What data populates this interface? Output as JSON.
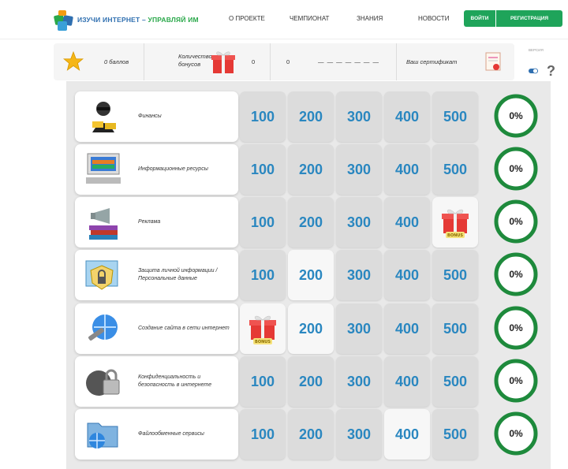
{
  "header": {
    "logo_text_1": "ИЗУЧИ ИНТЕРНЕТ – ",
    "logo_text_2": "УПРАВЛЯЙ ИМ",
    "nav": [
      "О ПРОЕКТЕ",
      "ЧЕМПИОНАТ",
      "ЗНАНИЯ",
      "НОВОСТИ"
    ],
    "login_label": "ВОЙТИ",
    "register_label": "РЕГИСТРАЦИЯ"
  },
  "stats": {
    "points": "0 баллов",
    "bonus_label": "Количество бонусов",
    "bonus_value": "0",
    "rank_value": "0",
    "dashes": "— — — — — — —",
    "certificate_label": "Ваш сертификат"
  },
  "help": {
    "symbol": "?",
    "tiny_label": "ВЕРСИЯ"
  },
  "colors": {
    "accent_green": "#1fa45a",
    "tile_blue": "#2a87c0",
    "ring_green": "#1e8a3c"
  },
  "board": {
    "rows": [
      {
        "category": "Финансы",
        "icon": "hacker-icon",
        "tiles": [
          "100",
          "200",
          "300",
          "400",
          "500"
        ],
        "progress": "0%"
      },
      {
        "category": "Информационные ресурсы",
        "icon": "books-computer-icon",
        "tiles": [
          "100",
          "200",
          "300",
          "400",
          "500"
        ],
        "progress": "0%"
      },
      {
        "category": "Реклама",
        "icon": "megaphone-books-icon",
        "tiles": [
          "100",
          "200",
          "300",
          "400",
          "BONUS"
        ],
        "progress": "0%"
      },
      {
        "category": "Защита личной информации / Персональные данные",
        "icon": "shield-lock-icon",
        "tiles": [
          "100",
          "200",
          "300",
          "400",
          "500"
        ],
        "progress": "0%"
      },
      {
        "category": "Создание сайта в сети интернет",
        "icon": "globe-wrench-icon",
        "tiles": [
          "BONUS",
          "200",
          "300",
          "400",
          "500"
        ],
        "progress": "0%"
      },
      {
        "category": "Конфиденциальность и безопасность в интернете",
        "icon": "padlock-ball-icon",
        "tiles": [
          "100",
          "200",
          "300",
          "400",
          "500"
        ],
        "progress": "0%"
      },
      {
        "category": "Файлообменные сервисы",
        "icon": "folder-globe-icon",
        "tiles": [
          "100",
          "200",
          "300",
          "400",
          "500"
        ],
        "progress": "0%"
      }
    ]
  }
}
